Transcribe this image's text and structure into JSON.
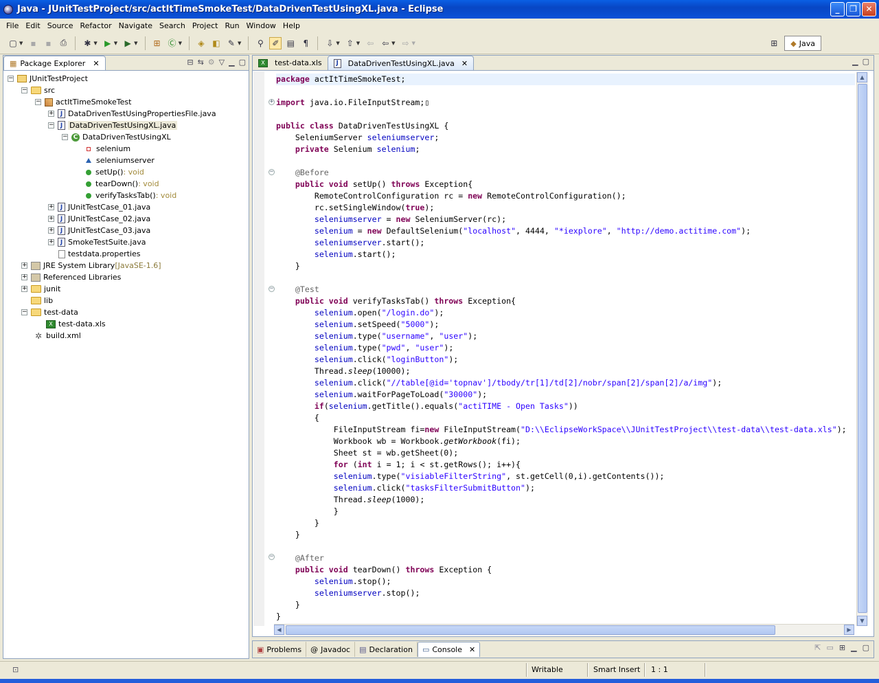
{
  "window": {
    "title": "Java - JUnitTestProject/src/actItTimeSmokeTest/DataDrivenTestUsingXL.java - Eclipse"
  },
  "menu": [
    "File",
    "Edit",
    "Source",
    "Refactor",
    "Navigate",
    "Search",
    "Project",
    "Run",
    "Window",
    "Help"
  ],
  "perspective": {
    "label": "Java"
  },
  "package_explorer": {
    "title": "Package Explorer",
    "tree": [
      {
        "label": "JUnitTestProject"
      },
      {
        "label": "src"
      },
      {
        "label": "actItTimeSmokeTest"
      },
      {
        "label": "DataDrivenTestUsingPropertiesFile.java"
      },
      {
        "label": "DataDrivenTestUsingXL.java"
      },
      {
        "label": "DataDrivenTestUsingXL"
      },
      {
        "label": "selenium"
      },
      {
        "label": "seleniumserver"
      },
      {
        "label": "setUp()",
        "suffix": " : void"
      },
      {
        "label": "tearDown()",
        "suffix": " : void"
      },
      {
        "label": "verifyTasksTab()",
        "suffix": " : void"
      },
      {
        "label": "JUnitTestCase_01.java"
      },
      {
        "label": "JUnitTestCase_02.java"
      },
      {
        "label": "JUnitTestCase_03.java"
      },
      {
        "label": "SmokeTestSuite.java"
      },
      {
        "label": "testdata.properties"
      },
      {
        "label": "JRE System Library",
        "suffix": " [JavaSE-1.6]"
      },
      {
        "label": "Referenced Libraries"
      },
      {
        "label": "junit"
      },
      {
        "label": "lib"
      },
      {
        "label": "test-data"
      },
      {
        "label": "test-data.xls"
      },
      {
        "label": "build.xml"
      }
    ]
  },
  "editor": {
    "tabs": [
      {
        "label": "test-data.xls"
      },
      {
        "label": "DataDrivenTestUsingXL.java"
      }
    ]
  },
  "bottom_tabs": [
    "Problems",
    "Javadoc",
    "Declaration",
    "Console"
  ],
  "status": {
    "mode": "Writable",
    "insert": "Smart Insert",
    "position": "1 : 1"
  },
  "colors": {
    "keyword": "#7f0055",
    "field": "#0000c0",
    "string": "#2a00ff",
    "annotation": "#646464",
    "titlebar": "#0a52d8"
  }
}
